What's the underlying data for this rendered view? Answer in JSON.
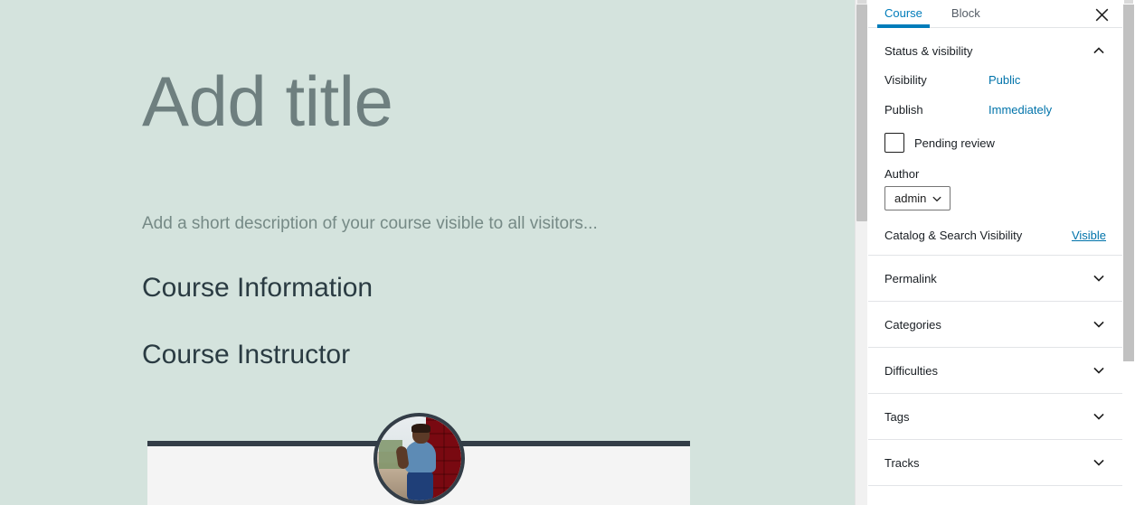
{
  "editor": {
    "title_placeholder": "Add title",
    "excerpt_placeholder": "Add a short description of your course visible to all visitors...",
    "blocks": [
      {
        "name": "course-information",
        "heading": "Course Information"
      },
      {
        "name": "course-instructor",
        "heading": "Course Instructor"
      }
    ],
    "background_color": "#d4e3dd",
    "title_color": "#6e7f7f",
    "heading_color": "#2a3b42",
    "instructor_card": {
      "accent_bar_color": "#333d47",
      "body_color": "#f4f4f4",
      "avatar_alt": "instructor-avatar-photo"
    }
  },
  "sidebar": {
    "tabs": [
      {
        "label": "Course",
        "active": true
      },
      {
        "label": "Block",
        "active": false
      }
    ],
    "close_label": "Close settings",
    "accent_color": "#007cba",
    "link_color": "#0073aa",
    "panels": [
      {
        "title": "Status & visibility",
        "expanded": true,
        "chevron": "chevron-up-icon",
        "rows": [
          {
            "label": "Visibility",
            "value": "Public"
          },
          {
            "label": "Publish",
            "value": "Immediately"
          }
        ],
        "pending_review": {
          "label": "Pending review",
          "checked": false
        },
        "author": {
          "label": "Author",
          "value": "admin"
        },
        "catalog": {
          "label": "Catalog & Search Visibility",
          "value": "Visible"
        }
      },
      {
        "title": "Permalink",
        "expanded": false,
        "chevron": "chevron-down-icon"
      },
      {
        "title": "Categories",
        "expanded": false,
        "chevron": "chevron-down-icon"
      },
      {
        "title": "Difficulties",
        "expanded": false,
        "chevron": "chevron-down-icon"
      },
      {
        "title": "Tags",
        "expanded": false,
        "chevron": "chevron-down-icon"
      },
      {
        "title": "Tracks",
        "expanded": false,
        "chevron": "chevron-down-icon"
      }
    ]
  }
}
